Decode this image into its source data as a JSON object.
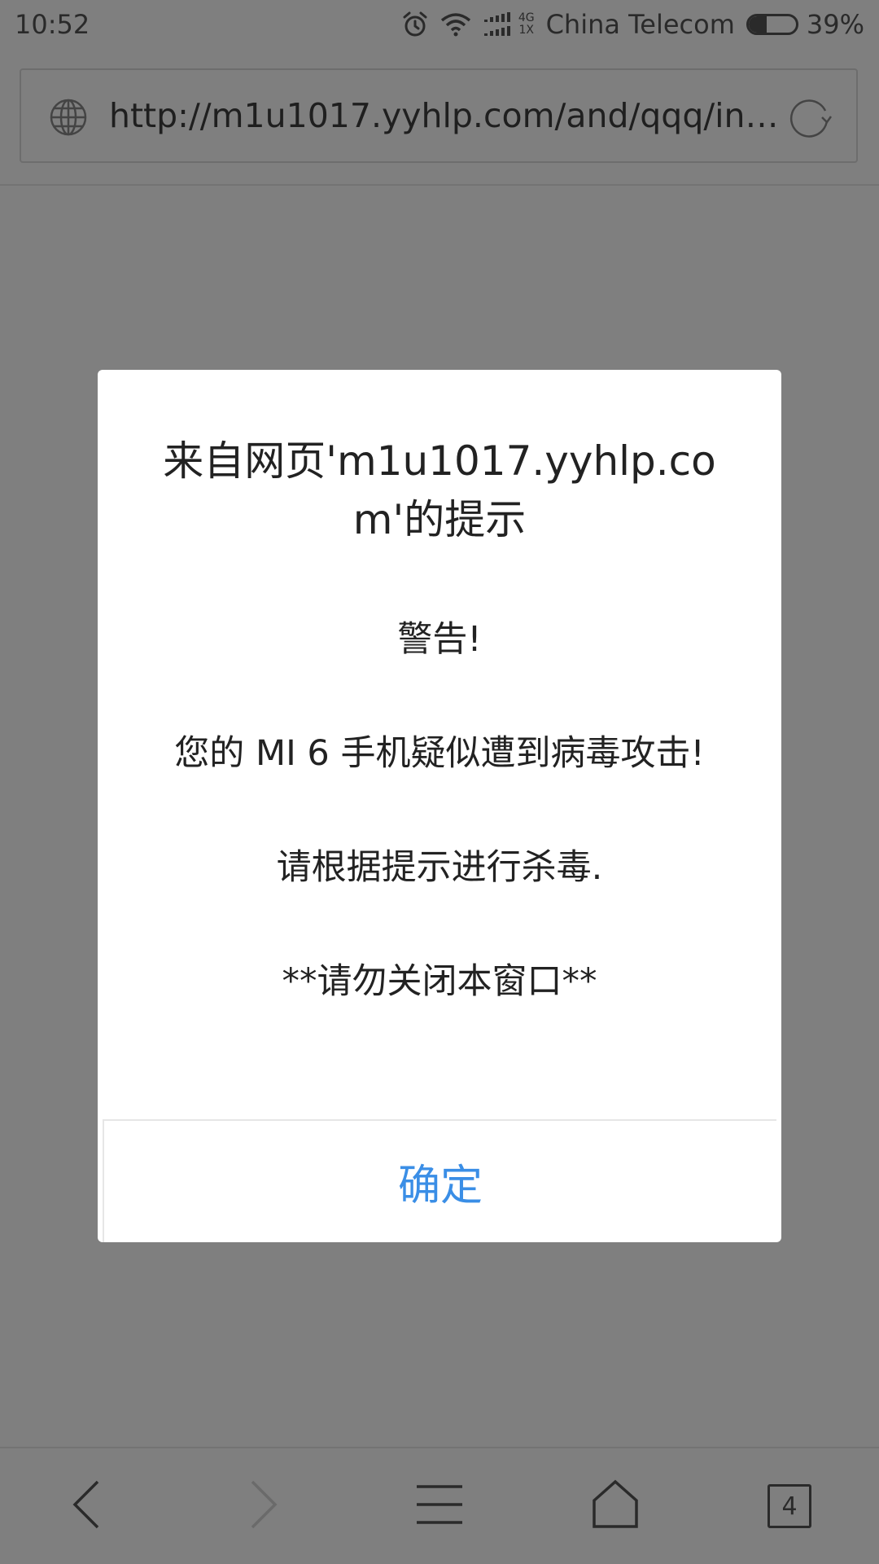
{
  "status_bar": {
    "time": "10:52",
    "net_type_top": "4G",
    "net_type_bottom": "1X",
    "carrier": "China Telecom",
    "battery_percent": "39%",
    "battery_level": 0.39,
    "icons": [
      "alarm-icon",
      "wifi-icon",
      "signal-icon",
      "battery-icon"
    ]
  },
  "address_bar": {
    "url": "http://m1u1017.yyhlp.com/and/qqq/inde…",
    "icons": [
      "globe-icon",
      "reload-icon"
    ]
  },
  "dialog": {
    "title": "来自网页'm1u1017.yyhlp.com'的提示",
    "message_lines": [
      "警告!",
      "",
      "您的 MI 6 手机疑似遭到病毒攻击!",
      "",
      "请根据提示进行杀毒.",
      "",
      "**请勿关闭本窗口**"
    ],
    "confirm_label": "确定"
  },
  "bottom_nav": {
    "tab_count": "4",
    "icons": [
      "back-icon",
      "forward-icon",
      "menu-icon",
      "home-icon",
      "tabs-icon"
    ]
  },
  "colors": {
    "overlay_bg": "#7f7f7f",
    "dialog_bg": "#ffffff",
    "accent": "#3a8ee6"
  }
}
